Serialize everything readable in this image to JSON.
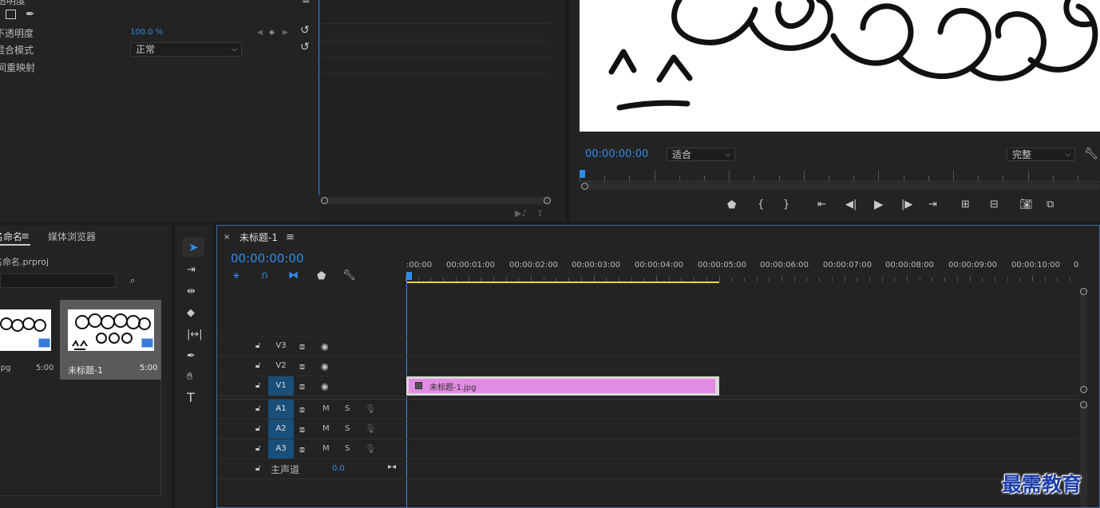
{
  "effect_controls": {
    "section_title": "透明度",
    "opacity_label": "不透明度",
    "opacity_value": "100.0 %",
    "blend_label": "混合模式",
    "blend_value": "正常",
    "remap_label": "时间重映射"
  },
  "program_monitor": {
    "timecode": "00:00:00:00",
    "fit_value": "适合",
    "quality_value": "完整"
  },
  "project": {
    "tab_name": "名命名",
    "tab_media_browser": "媒体浏览器",
    "project_file": "名命名.prproj",
    "items": [
      {
        "name": "jpg",
        "duration": "5:00"
      },
      {
        "name": "未标题-1",
        "duration": "5:00"
      }
    ]
  },
  "timeline": {
    "tab_title": "未标题-1",
    "timecode": "00:00:00:00",
    "ruler_labels": [
      ":00:00",
      "00:00:01:00",
      "00:00:02:00",
      "00:00:03:00",
      "00:00:04:00",
      "00:00:05:00",
      "00:00:06:00",
      "00:00:07:00",
      "00:00:08:00",
      "00:00:09:00",
      "00:00:10:00",
      "0"
    ],
    "video_tracks": [
      "V3",
      "V2",
      "V1"
    ],
    "audio_tracks": [
      "A1",
      "A2",
      "A3"
    ],
    "mute_label": "M",
    "solo_label": "S",
    "master_label": "主声道",
    "master_value": "0.0",
    "clip_label": "未标题-1.jpg",
    "clip_color": "#e28be2"
  },
  "watermark": "最需教育"
}
